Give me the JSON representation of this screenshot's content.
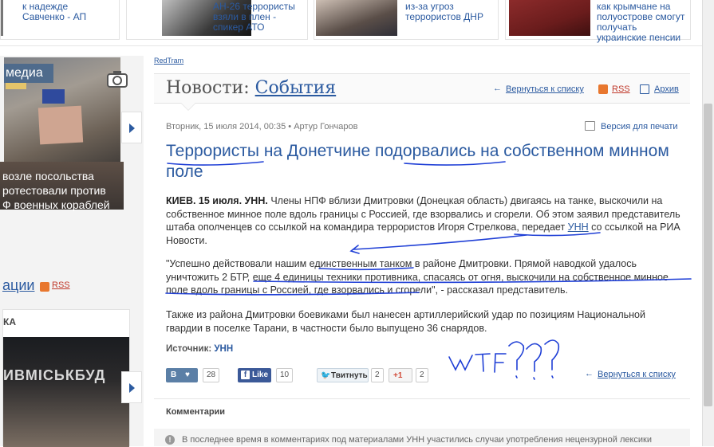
{
  "top_strip": {
    "cards": [
      {
        "text": "к надежде\nСавченко - АП"
      },
      {
        "text": "АН-26 террористы\nвзяли в плен -\nспикер АТО"
      },
      {
        "text": "из-за угроз\nтеррористов ДНР"
      },
      {
        "text": "как крымчане на\nполуострове смогут\nполучать\nукраинские пенсии"
      }
    ]
  },
  "left": {
    "media_tag": "медиа",
    "caption": "возле посольства\nротестовали против\nФ военных кораблей",
    "section_label": "ации",
    "rss": "RSS",
    "card_heading": "КА",
    "card_photo_text": "ИВМІСЬКБУД"
  },
  "header": {
    "redtram": "RedTram",
    "title_prefix": "Новости:",
    "title_link": "События",
    "back_to_list": "Вернуться к списку",
    "rss": "RSS",
    "archive": "Архив"
  },
  "article": {
    "meta": "Вторник, 15 июля 2014, 00:35 • Артур Гончаров",
    "print": "Версия для печати",
    "title": "Террористы на Донетчине подорвались на собственном минном поле",
    "p1_lead": "КИЕВ. 15 июля. УНН.",
    "p1_text": " Члены НПФ вблизи Дмитровки (Донецкая область) двигаясь на танке, выскочили на собственное минное поле вдоль границы с Россией, где взорвались и сгорели. Об этом заявил представитель штаба ополченцев со ссылкой на командира террористов Игоря Стрелкова, передает ",
    "p1_link": "УНН",
    "p1_tail": " со ссылкой на РИА Новости.",
    "p2": "\"Успешно действовали нашим единственным танком в районе Дмитровки. Прямой наводкой удалось уничтожить 2 БТР, еще 4 единицы техники противника, спасаясь от огня, выскочили на собственное минное поле вдоль границы с Россией, где взорвались и сгорели\", - рассказал представитель.",
    "p3": "Также из района Дмитровки боевиками был нанесен артиллерийский удар по позициям Национальной гвардии в поселке Тарани, в частности было выпущено 36 снарядов.",
    "source_label": "Источник:",
    "source_link": "УНН",
    "handwriting": "WTF???"
  },
  "share": {
    "vk_label": "В",
    "vk_count": "28",
    "fb_label": "Like",
    "fb_count": "10",
    "tw_label": "Твитнуть",
    "tw_count": "2",
    "gp_label": "+1",
    "gp_count": "2",
    "back_to_list": "Вернуться к списку"
  },
  "comments": {
    "heading": "Комментарии",
    "notice": "В последнее время в комментариях под материалами УНН участились случаи употребления нецензурной лексики"
  },
  "colors": {
    "link": "#2b5aa0",
    "ink": "#1f3fd6",
    "rss": "#e8772e"
  }
}
